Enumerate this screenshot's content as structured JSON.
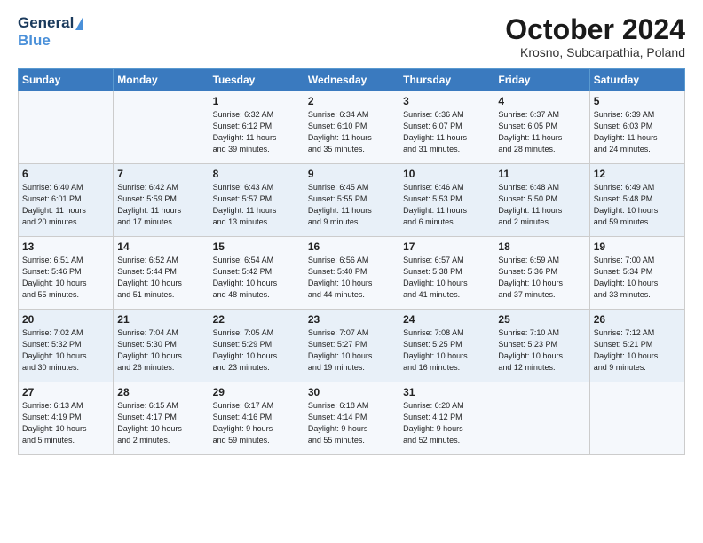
{
  "logo": {
    "line1": "General",
    "line2": "Blue"
  },
  "title": "October 2024",
  "subtitle": "Krosno, Subcarpathia, Poland",
  "days_header": [
    "Sunday",
    "Monday",
    "Tuesday",
    "Wednesday",
    "Thursday",
    "Friday",
    "Saturday"
  ],
  "weeks": [
    [
      {
        "day": "",
        "info": ""
      },
      {
        "day": "",
        "info": ""
      },
      {
        "day": "1",
        "info": "Sunrise: 6:32 AM\nSunset: 6:12 PM\nDaylight: 11 hours\nand 39 minutes."
      },
      {
        "day": "2",
        "info": "Sunrise: 6:34 AM\nSunset: 6:10 PM\nDaylight: 11 hours\nand 35 minutes."
      },
      {
        "day": "3",
        "info": "Sunrise: 6:36 AM\nSunset: 6:07 PM\nDaylight: 11 hours\nand 31 minutes."
      },
      {
        "day": "4",
        "info": "Sunrise: 6:37 AM\nSunset: 6:05 PM\nDaylight: 11 hours\nand 28 minutes."
      },
      {
        "day": "5",
        "info": "Sunrise: 6:39 AM\nSunset: 6:03 PM\nDaylight: 11 hours\nand 24 minutes."
      }
    ],
    [
      {
        "day": "6",
        "info": "Sunrise: 6:40 AM\nSunset: 6:01 PM\nDaylight: 11 hours\nand 20 minutes."
      },
      {
        "day": "7",
        "info": "Sunrise: 6:42 AM\nSunset: 5:59 PM\nDaylight: 11 hours\nand 17 minutes."
      },
      {
        "day": "8",
        "info": "Sunrise: 6:43 AM\nSunset: 5:57 PM\nDaylight: 11 hours\nand 13 minutes."
      },
      {
        "day": "9",
        "info": "Sunrise: 6:45 AM\nSunset: 5:55 PM\nDaylight: 11 hours\nand 9 minutes."
      },
      {
        "day": "10",
        "info": "Sunrise: 6:46 AM\nSunset: 5:53 PM\nDaylight: 11 hours\nand 6 minutes."
      },
      {
        "day": "11",
        "info": "Sunrise: 6:48 AM\nSunset: 5:50 PM\nDaylight: 11 hours\nand 2 minutes."
      },
      {
        "day": "12",
        "info": "Sunrise: 6:49 AM\nSunset: 5:48 PM\nDaylight: 10 hours\nand 59 minutes."
      }
    ],
    [
      {
        "day": "13",
        "info": "Sunrise: 6:51 AM\nSunset: 5:46 PM\nDaylight: 10 hours\nand 55 minutes."
      },
      {
        "day": "14",
        "info": "Sunrise: 6:52 AM\nSunset: 5:44 PM\nDaylight: 10 hours\nand 51 minutes."
      },
      {
        "day": "15",
        "info": "Sunrise: 6:54 AM\nSunset: 5:42 PM\nDaylight: 10 hours\nand 48 minutes."
      },
      {
        "day": "16",
        "info": "Sunrise: 6:56 AM\nSunset: 5:40 PM\nDaylight: 10 hours\nand 44 minutes."
      },
      {
        "day": "17",
        "info": "Sunrise: 6:57 AM\nSunset: 5:38 PM\nDaylight: 10 hours\nand 41 minutes."
      },
      {
        "day": "18",
        "info": "Sunrise: 6:59 AM\nSunset: 5:36 PM\nDaylight: 10 hours\nand 37 minutes."
      },
      {
        "day": "19",
        "info": "Sunrise: 7:00 AM\nSunset: 5:34 PM\nDaylight: 10 hours\nand 33 minutes."
      }
    ],
    [
      {
        "day": "20",
        "info": "Sunrise: 7:02 AM\nSunset: 5:32 PM\nDaylight: 10 hours\nand 30 minutes."
      },
      {
        "day": "21",
        "info": "Sunrise: 7:04 AM\nSunset: 5:30 PM\nDaylight: 10 hours\nand 26 minutes."
      },
      {
        "day": "22",
        "info": "Sunrise: 7:05 AM\nSunset: 5:29 PM\nDaylight: 10 hours\nand 23 minutes."
      },
      {
        "day": "23",
        "info": "Sunrise: 7:07 AM\nSunset: 5:27 PM\nDaylight: 10 hours\nand 19 minutes."
      },
      {
        "day": "24",
        "info": "Sunrise: 7:08 AM\nSunset: 5:25 PM\nDaylight: 10 hours\nand 16 minutes."
      },
      {
        "day": "25",
        "info": "Sunrise: 7:10 AM\nSunset: 5:23 PM\nDaylight: 10 hours\nand 12 minutes."
      },
      {
        "day": "26",
        "info": "Sunrise: 7:12 AM\nSunset: 5:21 PM\nDaylight: 10 hours\nand 9 minutes."
      }
    ],
    [
      {
        "day": "27",
        "info": "Sunrise: 6:13 AM\nSunset: 4:19 PM\nDaylight: 10 hours\nand 5 minutes."
      },
      {
        "day": "28",
        "info": "Sunrise: 6:15 AM\nSunset: 4:17 PM\nDaylight: 10 hours\nand 2 minutes."
      },
      {
        "day": "29",
        "info": "Sunrise: 6:17 AM\nSunset: 4:16 PM\nDaylight: 9 hours\nand 59 minutes."
      },
      {
        "day": "30",
        "info": "Sunrise: 6:18 AM\nSunset: 4:14 PM\nDaylight: 9 hours\nand 55 minutes."
      },
      {
        "day": "31",
        "info": "Sunrise: 6:20 AM\nSunset: 4:12 PM\nDaylight: 9 hours\nand 52 minutes."
      },
      {
        "day": "",
        "info": ""
      },
      {
        "day": "",
        "info": ""
      }
    ]
  ]
}
